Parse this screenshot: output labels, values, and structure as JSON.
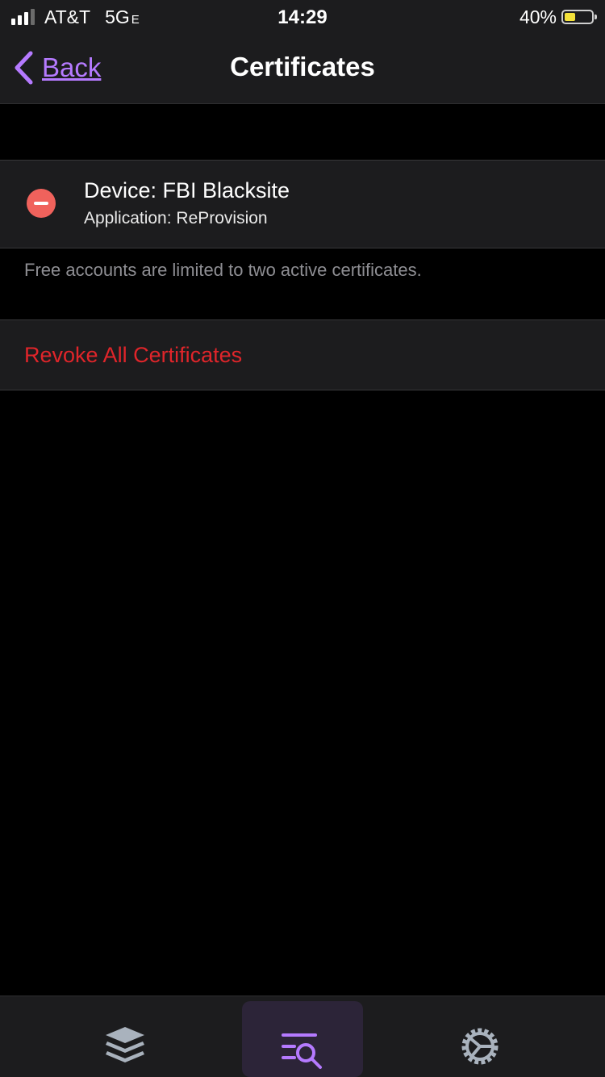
{
  "status_bar": {
    "carrier": "AT&T",
    "network": "5G",
    "network_suffix": "E",
    "time": "14:29",
    "battery_percent": "40%",
    "battery_level": 0.4,
    "signal_bars_filled": 3,
    "signal_bars_total": 4
  },
  "nav": {
    "back_label": "Back",
    "title": "Certificates"
  },
  "certificates": [
    {
      "device": "Device: FBI Blacksite",
      "application": "Application: ReProvision"
    }
  ],
  "footer_note": "Free accounts are limited to two active certificates.",
  "revoke_all_label": "Revoke All Certificates",
  "tab_bar": {
    "tabs": [
      {
        "icon": "stack-icon",
        "active": false
      },
      {
        "icon": "search-list-icon",
        "active": true
      },
      {
        "icon": "gear-icon",
        "active": false
      }
    ]
  },
  "colors": {
    "accent": "#b57aff",
    "destructive": "#e0252a",
    "delete_control": "#f0625c",
    "battery_fill": "#f4e23a"
  }
}
